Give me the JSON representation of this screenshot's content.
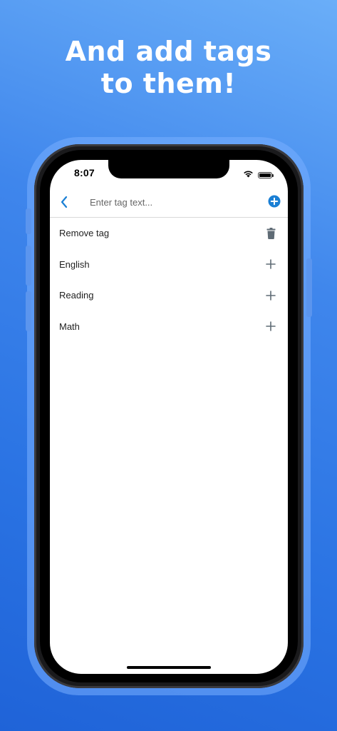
{
  "headline": {
    "line1": "And add tags",
    "line2": "to them!"
  },
  "status_bar": {
    "time": "8:07",
    "icons": [
      "wifi-icon",
      "battery-icon"
    ]
  },
  "navbar": {
    "back_icon": "chevron-left-icon",
    "input_value": "",
    "input_placeholder": "Enter tag text...",
    "add_icon": "plus-circle-icon",
    "accent_color": "#1a7fd4"
  },
  "list": {
    "items": [
      {
        "label": "Remove tag",
        "icon": "trash-icon"
      },
      {
        "label": "English",
        "icon": "plus-icon"
      },
      {
        "label": "Reading",
        "icon": "plus-icon"
      },
      {
        "label": "Math",
        "icon": "plus-icon"
      }
    ],
    "icon_color": "#5f6b75"
  },
  "colors": {
    "background_top": "#6aaef8",
    "background_bottom": "#1f63d8"
  }
}
